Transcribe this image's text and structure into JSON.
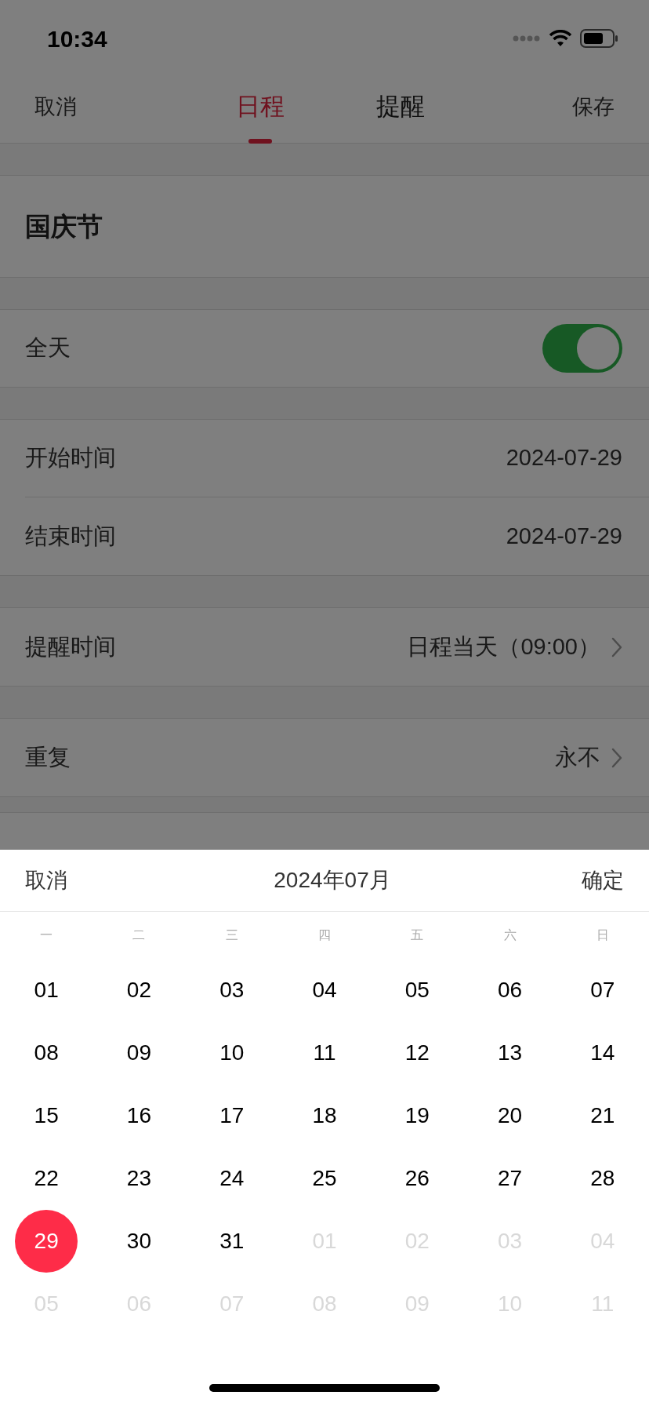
{
  "status_bar": {
    "time": "10:34"
  },
  "nav": {
    "cancel": "取消",
    "tabs": [
      {
        "label": "日程",
        "selected": true
      },
      {
        "label": "提醒",
        "selected": false
      }
    ],
    "save": "保存"
  },
  "title": "国庆节",
  "all_day": {
    "label": "全天",
    "on": true
  },
  "times": [
    {
      "label": "开始时间",
      "value": "2024-07-29"
    },
    {
      "label": "结束时间",
      "value": "2024-07-29"
    }
  ],
  "reminder": {
    "label": "提醒时间",
    "value": "日程当天（09:00）"
  },
  "repeat": {
    "label": "重复",
    "value": "永不"
  },
  "picker": {
    "cancel": "取消",
    "title": "2024年07月",
    "confirm": "确定",
    "weekdays": [
      "一",
      "二",
      "三",
      "四",
      "五",
      "六",
      "日"
    ],
    "days": [
      {
        "label": "01",
        "in_month": true,
        "selected": false
      },
      {
        "label": "02",
        "in_month": true,
        "selected": false
      },
      {
        "label": "03",
        "in_month": true,
        "selected": false
      },
      {
        "label": "04",
        "in_month": true,
        "selected": false
      },
      {
        "label": "05",
        "in_month": true,
        "selected": false
      },
      {
        "label": "06",
        "in_month": true,
        "selected": false
      },
      {
        "label": "07",
        "in_month": true,
        "selected": false
      },
      {
        "label": "08",
        "in_month": true,
        "selected": false
      },
      {
        "label": "09",
        "in_month": true,
        "selected": false
      },
      {
        "label": "10",
        "in_month": true,
        "selected": false
      },
      {
        "label": "11",
        "in_month": true,
        "selected": false
      },
      {
        "label": "12",
        "in_month": true,
        "selected": false
      },
      {
        "label": "13",
        "in_month": true,
        "selected": false
      },
      {
        "label": "14",
        "in_month": true,
        "selected": false
      },
      {
        "label": "15",
        "in_month": true,
        "selected": false
      },
      {
        "label": "16",
        "in_month": true,
        "selected": false
      },
      {
        "label": "17",
        "in_month": true,
        "selected": false
      },
      {
        "label": "18",
        "in_month": true,
        "selected": false
      },
      {
        "label": "19",
        "in_month": true,
        "selected": false
      },
      {
        "label": "20",
        "in_month": true,
        "selected": false
      },
      {
        "label": "21",
        "in_month": true,
        "selected": false
      },
      {
        "label": "22",
        "in_month": true,
        "selected": false
      },
      {
        "label": "23",
        "in_month": true,
        "selected": false
      },
      {
        "label": "24",
        "in_month": true,
        "selected": false
      },
      {
        "label": "25",
        "in_month": true,
        "selected": false
      },
      {
        "label": "26",
        "in_month": true,
        "selected": false
      },
      {
        "label": "27",
        "in_month": true,
        "selected": false
      },
      {
        "label": "28",
        "in_month": true,
        "selected": false
      },
      {
        "label": "29",
        "in_month": true,
        "selected": true
      },
      {
        "label": "30",
        "in_month": true,
        "selected": false
      },
      {
        "label": "31",
        "in_month": true,
        "selected": false
      },
      {
        "label": "01",
        "in_month": false,
        "selected": false
      },
      {
        "label": "02",
        "in_month": false,
        "selected": false
      },
      {
        "label": "03",
        "in_month": false,
        "selected": false
      },
      {
        "label": "04",
        "in_month": false,
        "selected": false
      },
      {
        "label": "05",
        "in_month": false,
        "selected": false
      },
      {
        "label": "06",
        "in_month": false,
        "selected": false
      },
      {
        "label": "07",
        "in_month": false,
        "selected": false
      },
      {
        "label": "08",
        "in_month": false,
        "selected": false
      },
      {
        "label": "09",
        "in_month": false,
        "selected": false
      },
      {
        "label": "10",
        "in_month": false,
        "selected": false
      },
      {
        "label": "11",
        "in_month": false,
        "selected": false
      }
    ]
  }
}
